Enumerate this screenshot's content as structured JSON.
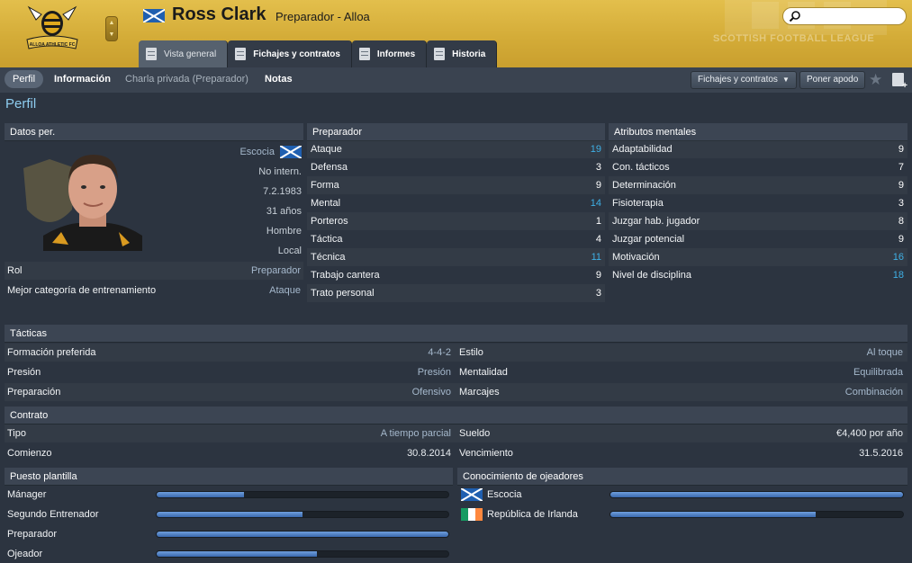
{
  "header": {
    "name": "Ross Clark",
    "subtitle": "Preparador - Alloa",
    "club_crest_text": "ALLOA ATHLETIC FC",
    "watermark": "SCOTTISH FOOTBALL LEAGUE",
    "search_placeholder": ""
  },
  "tabs": [
    {
      "label": "Vista general"
    },
    {
      "label": "Fichajes y contratos"
    },
    {
      "label": "Informes"
    },
    {
      "label": "Historia"
    }
  ],
  "subnav": {
    "items": [
      "Perfil",
      "Información",
      "Charla privada (Preparador)",
      "Notas"
    ],
    "dropdown_label": "Fichajes y contratos",
    "nickname_button": "Poner apodo"
  },
  "page_title": "Perfil",
  "personal": {
    "header": "Datos per.",
    "nationality": "Escocia",
    "intl": "No intern.",
    "dob": "7.2.1983",
    "age": "31 años",
    "gender": "Hombre",
    "status": "Local",
    "rows": [
      {
        "label": "Rol",
        "value": "Preparador"
      },
      {
        "label": "Mejor categoría de entrenamiento",
        "value": "Ataque"
      }
    ]
  },
  "coach": {
    "header": "Preparador",
    "attrs": [
      {
        "label": "Ataque",
        "value": "19"
      },
      {
        "label": "Defensa",
        "value": "3"
      },
      {
        "label": "Forma",
        "value": "9"
      },
      {
        "label": "Mental",
        "value": "14"
      },
      {
        "label": "Porteros",
        "value": "1"
      },
      {
        "label": "Táctica",
        "value": "4"
      },
      {
        "label": "Técnica",
        "value": "11"
      },
      {
        "label": "Trabajo cantera",
        "value": "9"
      },
      {
        "label": "Trato personal",
        "value": "3"
      }
    ]
  },
  "mental": {
    "header": "Atributos mentales",
    "attrs": [
      {
        "label": "Adaptabilidad",
        "value": "9"
      },
      {
        "label": "Con. tácticos",
        "value": "7"
      },
      {
        "label": "Determinación",
        "value": "9"
      },
      {
        "label": "Fisioterapia",
        "value": "3"
      },
      {
        "label": "Juzgar hab. jugador",
        "value": "8"
      },
      {
        "label": "Juzgar potencial",
        "value": "9"
      },
      {
        "label": "Motivación",
        "value": "16"
      },
      {
        "label": "Nivel de disciplina",
        "value": "18"
      }
    ]
  },
  "tactics": {
    "header": "Tácticas",
    "rows": [
      {
        "l1": "Formación preferida",
        "v1": "4-4-2",
        "l2": "Estilo",
        "v2": "Al toque"
      },
      {
        "l1": "Presión",
        "v1": "Presión",
        "l2": "Mentalidad",
        "v2": "Equilibrada"
      },
      {
        "l1": "Preparación",
        "v1": "Ofensivo",
        "l2": "Marcajes",
        "v2": "Combinación"
      }
    ]
  },
  "contract": {
    "header": "Contrato",
    "rows": [
      {
        "l1": "Tipo",
        "v1": "A tiempo parcial",
        "l2": "Sueldo",
        "v2": "€4,400 por año"
      },
      {
        "l1": "Comienzo",
        "v1": "30.8.2014",
        "l2": "Vencimiento",
        "v2": "31.5.2016"
      }
    ]
  },
  "staff_role": {
    "header": "Puesto plantilla",
    "items": [
      {
        "label": "Mánager",
        "level": 0.3
      },
      {
        "label": "Segundo Entrenador",
        "level": 0.5
      },
      {
        "label": "Preparador",
        "level": 1.0
      },
      {
        "label": "Ojeador",
        "level": 0.55
      }
    ]
  },
  "scout_knowledge": {
    "header": "Conocimiento de ojeadores",
    "items": [
      {
        "label": "Escocia",
        "flag": "scotland",
        "level": 1.0
      },
      {
        "label": "República de Irlanda",
        "flag": "ireland",
        "level": 0.7
      }
    ]
  },
  "colors": {
    "header_gold": "#d4ac38",
    "accent_blue": "#3fb0e6",
    "bar_fill": "#4a7cc4"
  }
}
